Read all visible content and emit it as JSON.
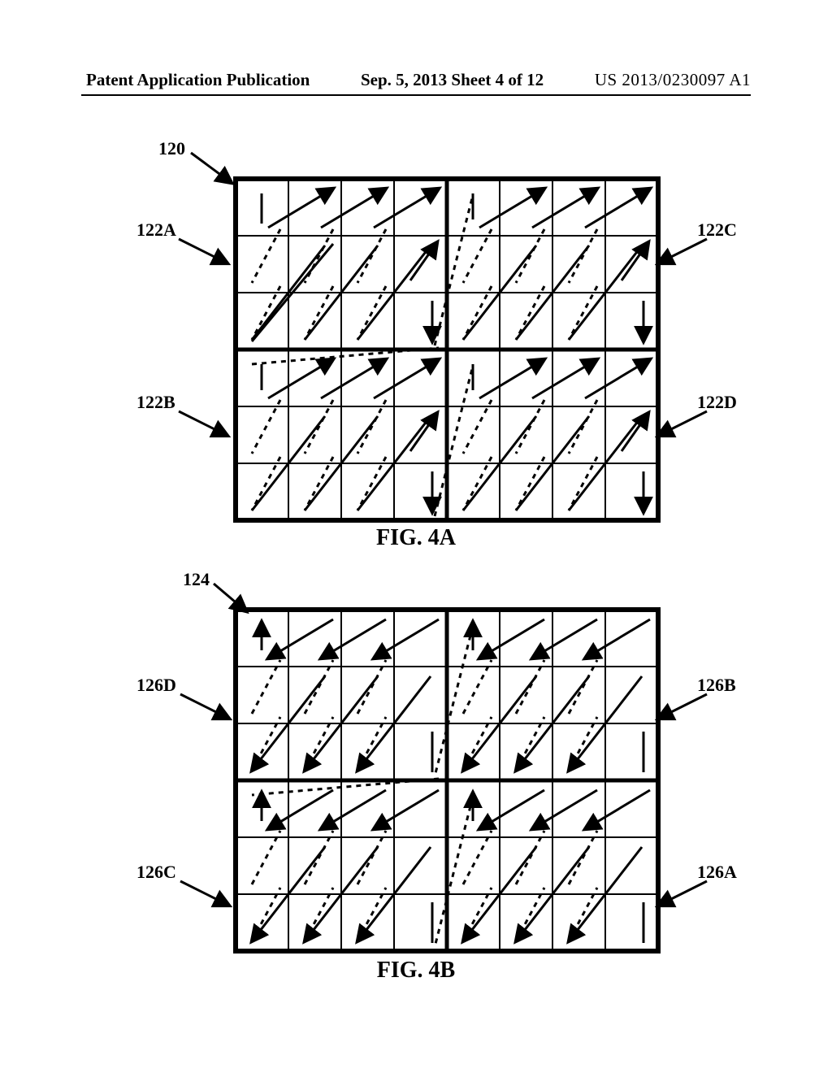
{
  "header": {
    "left": "Patent Application Publication",
    "center": "Sep. 5, 2013  Sheet 4 of 12",
    "right": "US 2013/0230097 A1"
  },
  "figures": {
    "a": {
      "ref": "120",
      "caption": "FIG. 4A",
      "quad_labels": {
        "tl": "122A",
        "bl": "122B",
        "tr": "122C",
        "br": "122D"
      }
    },
    "b": {
      "ref": "124",
      "caption": "FIG. 4B",
      "quad_labels": {
        "tl": "126D",
        "bl": "126C",
        "tr": "126B",
        "br": "126A"
      }
    }
  },
  "chart_data": {
    "type": "diagram",
    "description": "Two figures (4A, 4B) each show an 8x6 block subdivided into four 4x3 quadrants. Each cell has a diagonal scan-arrow. Fig 4A: forward scan (arrows toward upper-right). Fig 4B: reverse scan (arrows toward lower-left). Quadrant reference numerals listed per figure.",
    "fig4a": {
      "block_ref": 120,
      "grid": {
        "cols": 8,
        "rows": 6,
        "quad_cols": 4,
        "quad_rows": 3
      },
      "scan_direction": "forward-upper-right",
      "quadrants": [
        {
          "pos": "top-left",
          "ref": "122A"
        },
        {
          "pos": "bottom-left",
          "ref": "122B"
        },
        {
          "pos": "top-right",
          "ref": "122C"
        },
        {
          "pos": "bottom-right",
          "ref": "122D"
        }
      ]
    },
    "fig4b": {
      "block_ref": 124,
      "grid": {
        "cols": 8,
        "rows": 6,
        "quad_cols": 4,
        "quad_rows": 3
      },
      "scan_direction": "reverse-lower-left",
      "quadrants": [
        {
          "pos": "top-left",
          "ref": "126D"
        },
        {
          "pos": "bottom-left",
          "ref": "126C"
        },
        {
          "pos": "top-right",
          "ref": "126B"
        },
        {
          "pos": "bottom-right",
          "ref": "126A"
        }
      ]
    }
  }
}
